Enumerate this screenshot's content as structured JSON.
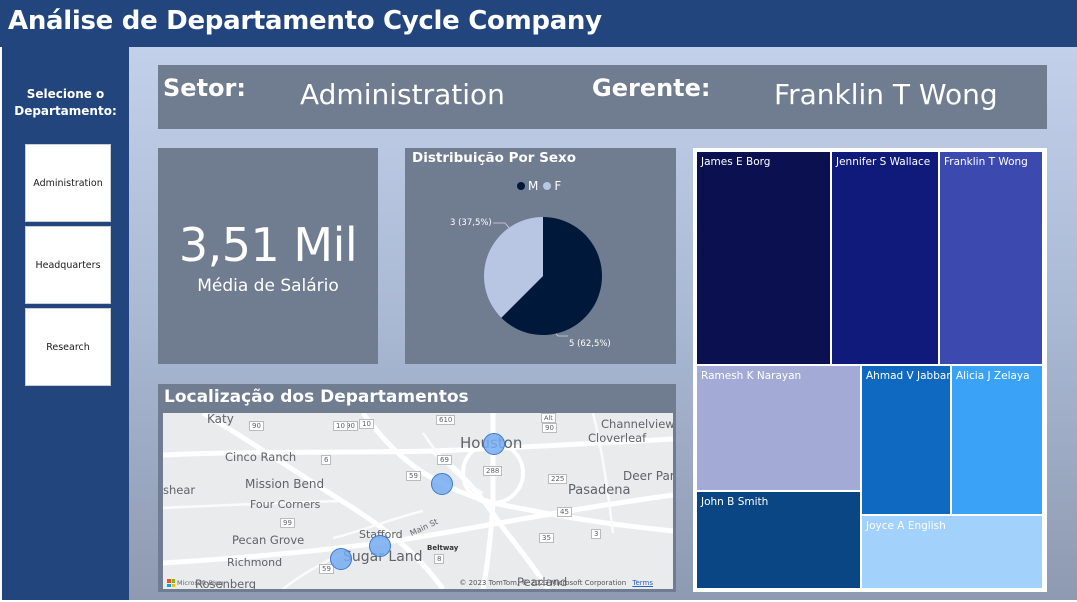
{
  "app": {
    "title": "Análise de Departamento Cycle Company"
  },
  "sidebar": {
    "title_line1": "Selecione o",
    "title_line2": "Departamento:",
    "departments": [
      "Administration",
      "Headquarters",
      "Research"
    ]
  },
  "header_card": {
    "setor_label": "Setor:",
    "setor_value": "Administration",
    "gerente_label": "Gerente:",
    "gerente_value": "Franklin T Wong"
  },
  "kpi": {
    "value": "3,51 Mil",
    "label": "Média de Salário"
  },
  "chart_data": {
    "type": "pie",
    "title": "Distribuição Por Sexo",
    "legend": [
      "M",
      "F"
    ],
    "slices": [
      {
        "label": "M",
        "value": 5,
        "percent": "62,5%",
        "color": "#00183a"
      },
      {
        "label": "F",
        "value": 3,
        "percent": "37,5%",
        "color": "#b8c6e3"
      }
    ],
    "data_labels": [
      "3 (37,5%)",
      "5 (62,5%)"
    ],
    "legend_placement": "top"
  },
  "map": {
    "title": "Localização dos Departamentos",
    "credit": "© 2023 TomTom, © 2023 Microsoft Corporation",
    "terms": "Terms",
    "logo_text": "Microsoft Bing",
    "places": [
      "Katy",
      "Channelview",
      "Cloverleaf",
      "Houston",
      "Cinco Ranch",
      "Mission Bend",
      "Deer Par",
      "Pasadena",
      "shear",
      "Four Corners",
      "Stafford",
      "Pecan Grove",
      "Sugar Land",
      "Richmond",
      "Rosenberg",
      "Pearland",
      "Beltway",
      "Main St"
    ],
    "road_numbers": [
      "90",
      "10",
      "90",
      "10",
      "610",
      "Alt",
      "90",
      "6",
      "69",
      "288",
      "59",
      "225",
      "99",
      "45",
      "35",
      "3",
      "8",
      "59"
    ]
  },
  "treemap": {
    "cells": [
      "James E Borg",
      "Jennifer S Wallace",
      "Franklin T Wong",
      "Ramesh K Narayan",
      "Ahmad V Jabbar",
      "Alicia J Zelaya",
      "John B Smith",
      "Joyce A English"
    ]
  },
  "colors": {
    "header": "#22457e",
    "card": "#707c8f",
    "pie_m": "#00183a",
    "pie_f": "#b8c6e3"
  }
}
